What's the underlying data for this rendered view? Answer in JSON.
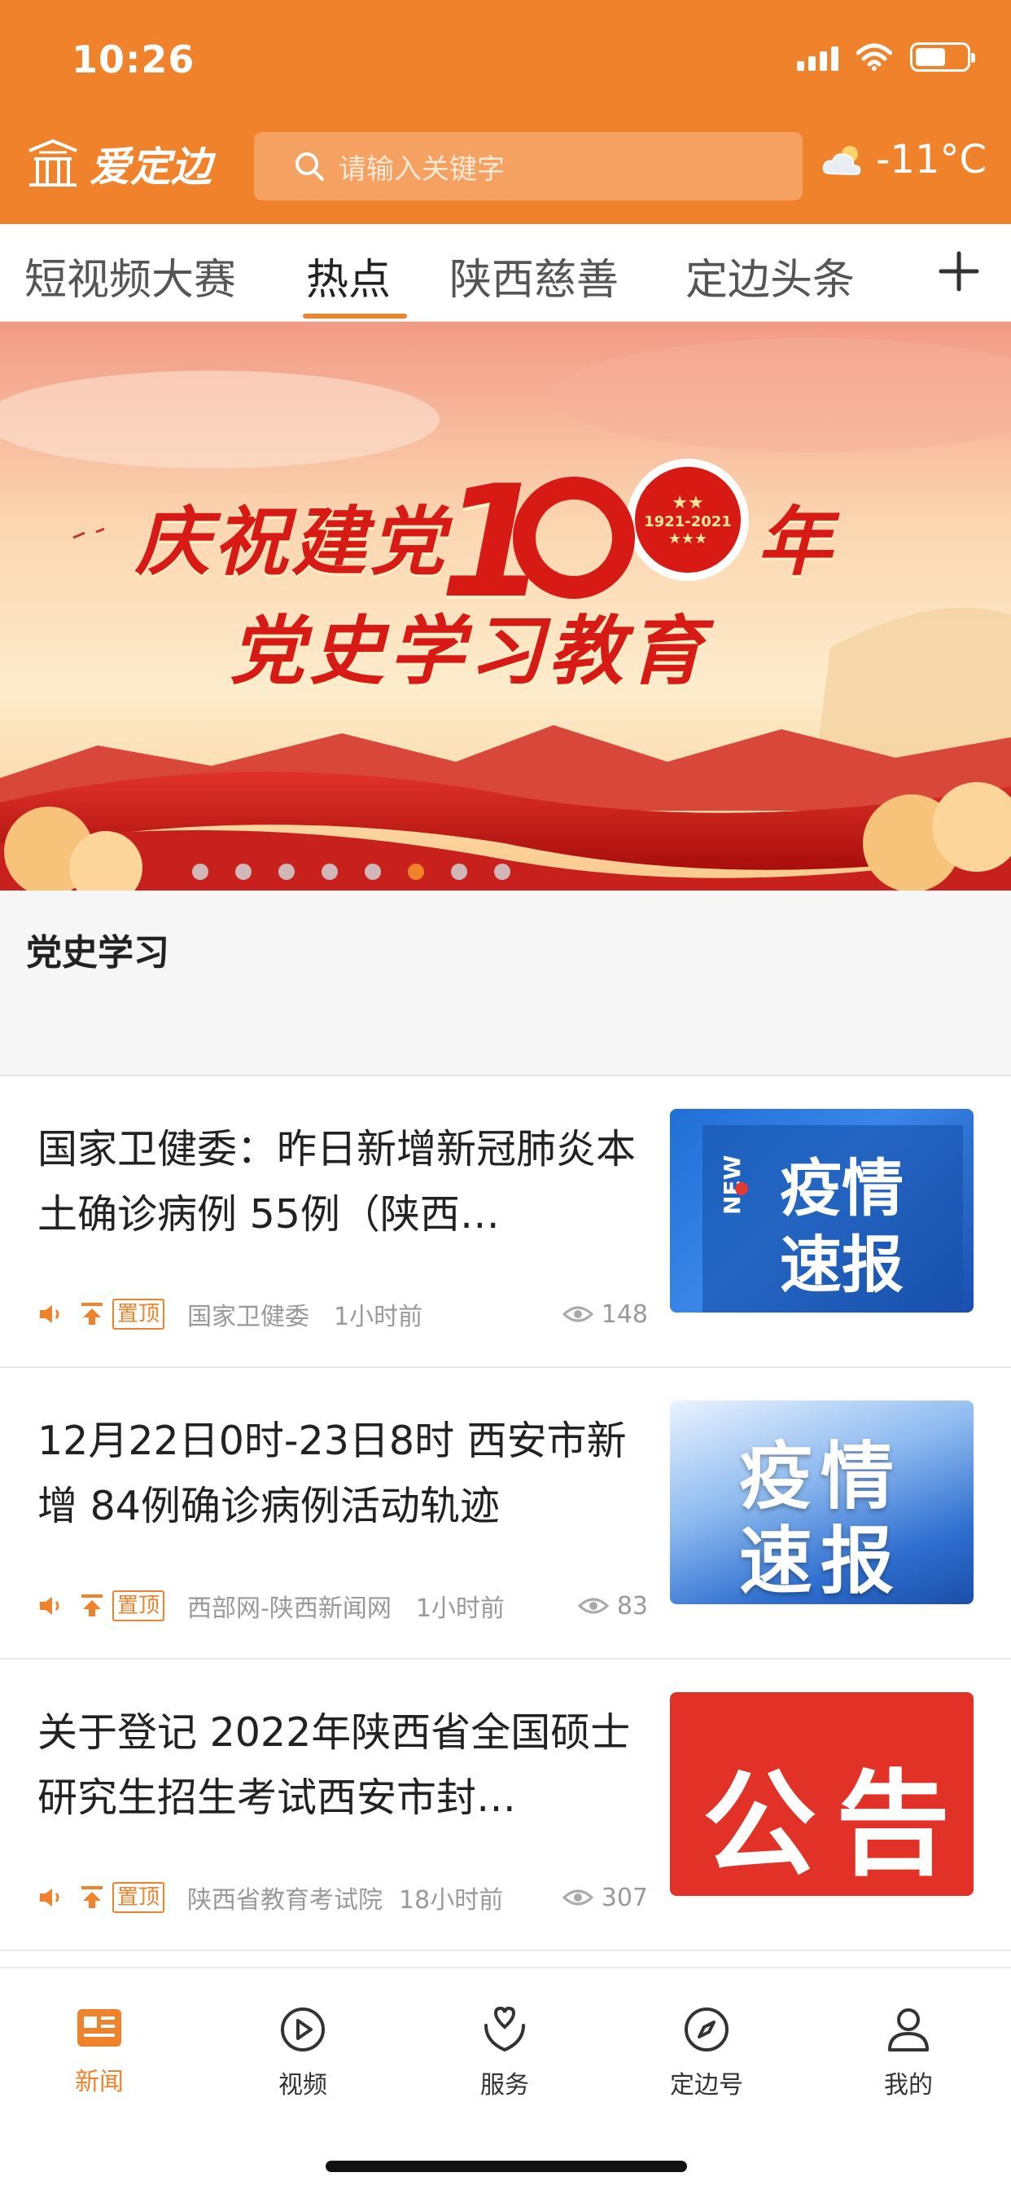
{
  "status_bar": {
    "time": "10:26"
  },
  "header": {
    "logo_text": "爱定边",
    "search_placeholder": "请输入关键字",
    "weather_temp": "-11°C"
  },
  "tabs": [
    {
      "label": "短视频大赛"
    },
    {
      "label": "热点",
      "active": true
    },
    {
      "label": "陕西慈善"
    },
    {
      "label": "定边头条"
    }
  ],
  "banner": {
    "line1_left": "庆祝建党",
    "line1_number": "1",
    "line1_number_rest": "00",
    "line1_badge": "1921-2021",
    "line1_right": "年",
    "line2": "党史学习教育",
    "dot_count": 8,
    "active_dot_index": 5
  },
  "section": {
    "title": "党史学习"
  },
  "news": [
    {
      "title": "国家卫健委：昨日新增新冠肺炎本土确诊病例 55例（陕西…",
      "tag": "置顶",
      "source": "国家卫健委",
      "time": "1小时前",
      "views": "148",
      "thumb_line1": "疫情",
      "thumb_line2": "速报",
      "thumb_badge": "NEW"
    },
    {
      "title": "12月22日0时-23日8时 西安市新增 84例确诊病例活动轨迹",
      "tag": "置顶",
      "source": "西部网-陕西新闻网",
      "time": "1小时前",
      "views": "83",
      "thumb_line1": "疫情",
      "thumb_line2": "速报"
    },
    {
      "title": "关于登记 2022年陕西省全国硕士研究生招生考试西安市封…",
      "tag": "置顶",
      "source": "陕西省教育考试院",
      "time": "18小时前",
      "views": "307",
      "thumb_line1": "公告"
    }
  ],
  "bottom_nav": [
    {
      "label": "新闻",
      "icon": "news-icon",
      "active": true
    },
    {
      "label": "视频",
      "icon": "play-icon"
    },
    {
      "label": "服务",
      "icon": "heart-hand-icon"
    },
    {
      "label": "定边号",
      "icon": "compass-icon"
    },
    {
      "label": "我的",
      "icon": "person-icon"
    }
  ],
  "colors": {
    "accent": "#f0822b",
    "banner_red": "#d71a14",
    "thumb_blue": "#1e63c8",
    "thumb_red": "#e23126"
  }
}
